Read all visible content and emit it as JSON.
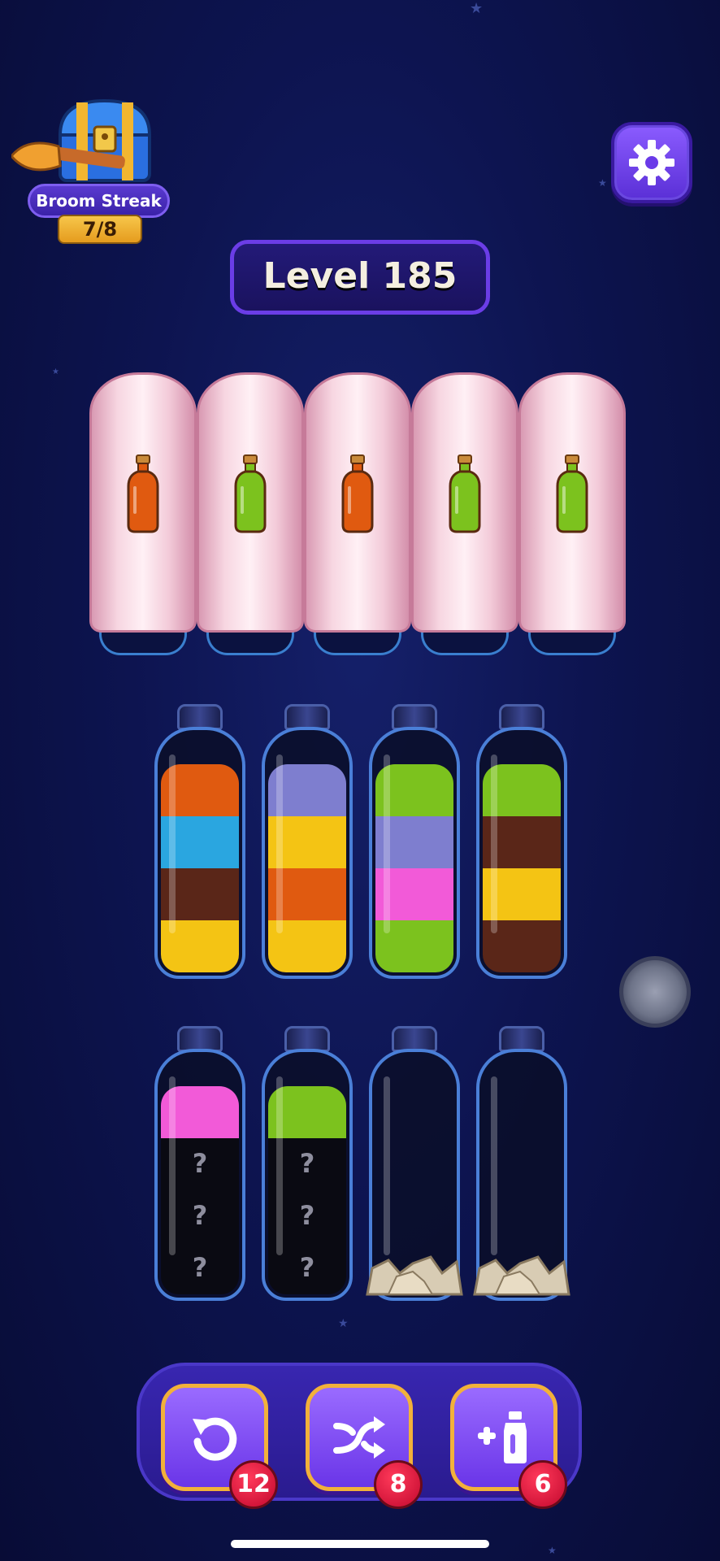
{
  "streak": {
    "label": "Broom Streak",
    "count": "7/8"
  },
  "level": {
    "title": "Level 185"
  },
  "colors": {
    "orange": "#e05a10",
    "blue": "#2aa6e0",
    "brown": "#5a2618",
    "yellow": "#f4c414",
    "lavender": "#7e7ecf",
    "green": "#7cc21e",
    "pink": "#f25ad8"
  },
  "covered_bottles": [
    "orange",
    "green",
    "orange",
    "green",
    "green"
  ],
  "tubes_row1": [
    {
      "layers_top_to_bottom": [
        "orange",
        "blue",
        "brown",
        "yellow"
      ]
    },
    {
      "layers_top_to_bottom": [
        "lavender",
        "yellow",
        "orange",
        "yellow"
      ]
    },
    {
      "layers_top_to_bottom": [
        "green",
        "lavender",
        "pink",
        "green"
      ]
    },
    {
      "layers_top_to_bottom": [
        "green",
        "brown",
        "yellow",
        "brown"
      ]
    }
  ],
  "tubes_row2": [
    {
      "layers_top_to_bottom": [
        "pink"
      ],
      "hidden": [
        "?",
        "?",
        "?"
      ]
    },
    {
      "layers_top_to_bottom": [
        "green"
      ],
      "hidden": [
        "?",
        "?",
        "?"
      ]
    },
    {
      "layers_top_to_bottom": [],
      "blocked": "rocks"
    },
    {
      "layers_top_to_bottom": [],
      "blocked": "rocks"
    }
  ],
  "tools": {
    "undo": {
      "icon": "undo-icon",
      "count": "12"
    },
    "shuffle": {
      "icon": "shuffle-icon",
      "count": "8"
    },
    "add_bottle": {
      "icon": "add-bottle-icon",
      "count": "6"
    }
  }
}
